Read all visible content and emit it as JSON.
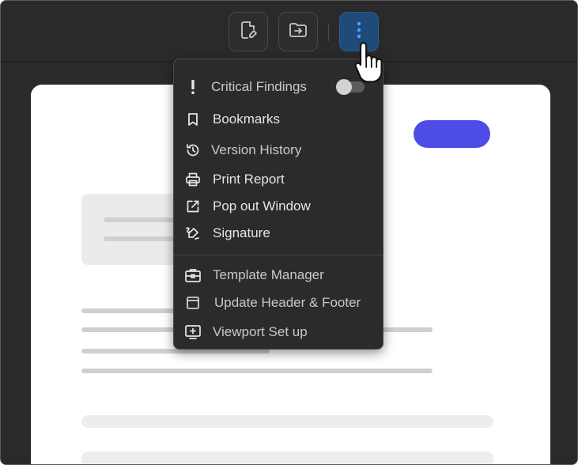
{
  "toolbar": {
    "buttons": [
      {
        "icon": "edit-document-icon"
      },
      {
        "icon": "folder-import-icon"
      },
      {
        "icon": "more-vertical-icon",
        "active": true
      }
    ]
  },
  "menu": {
    "critical_findings": {
      "label": "Critical Findings",
      "icon": "exclamation-icon",
      "toggle_on": false
    },
    "items": [
      {
        "label": "Bookmarks",
        "icon": "bookmark-icon"
      },
      {
        "label": "Version History",
        "icon": "history-icon"
      },
      {
        "label": "Print Report",
        "icon": "printer-icon"
      },
      {
        "label": "Pop out Window",
        "icon": "external-link-icon"
      },
      {
        "label": "Signature",
        "icon": "signature-icon"
      }
    ],
    "items_secondary": [
      {
        "label": "Template Manager",
        "icon": "toolbox-icon"
      },
      {
        "label": "Update Header & Footer",
        "icon": "header-footer-icon"
      },
      {
        "label": "Viewport Set up",
        "icon": "viewport-icon"
      }
    ]
  },
  "colors": {
    "accent_button": "#4b4de6",
    "active_toolbar_button": "#1f4a7a",
    "menu_background": "#2b2b2b"
  }
}
